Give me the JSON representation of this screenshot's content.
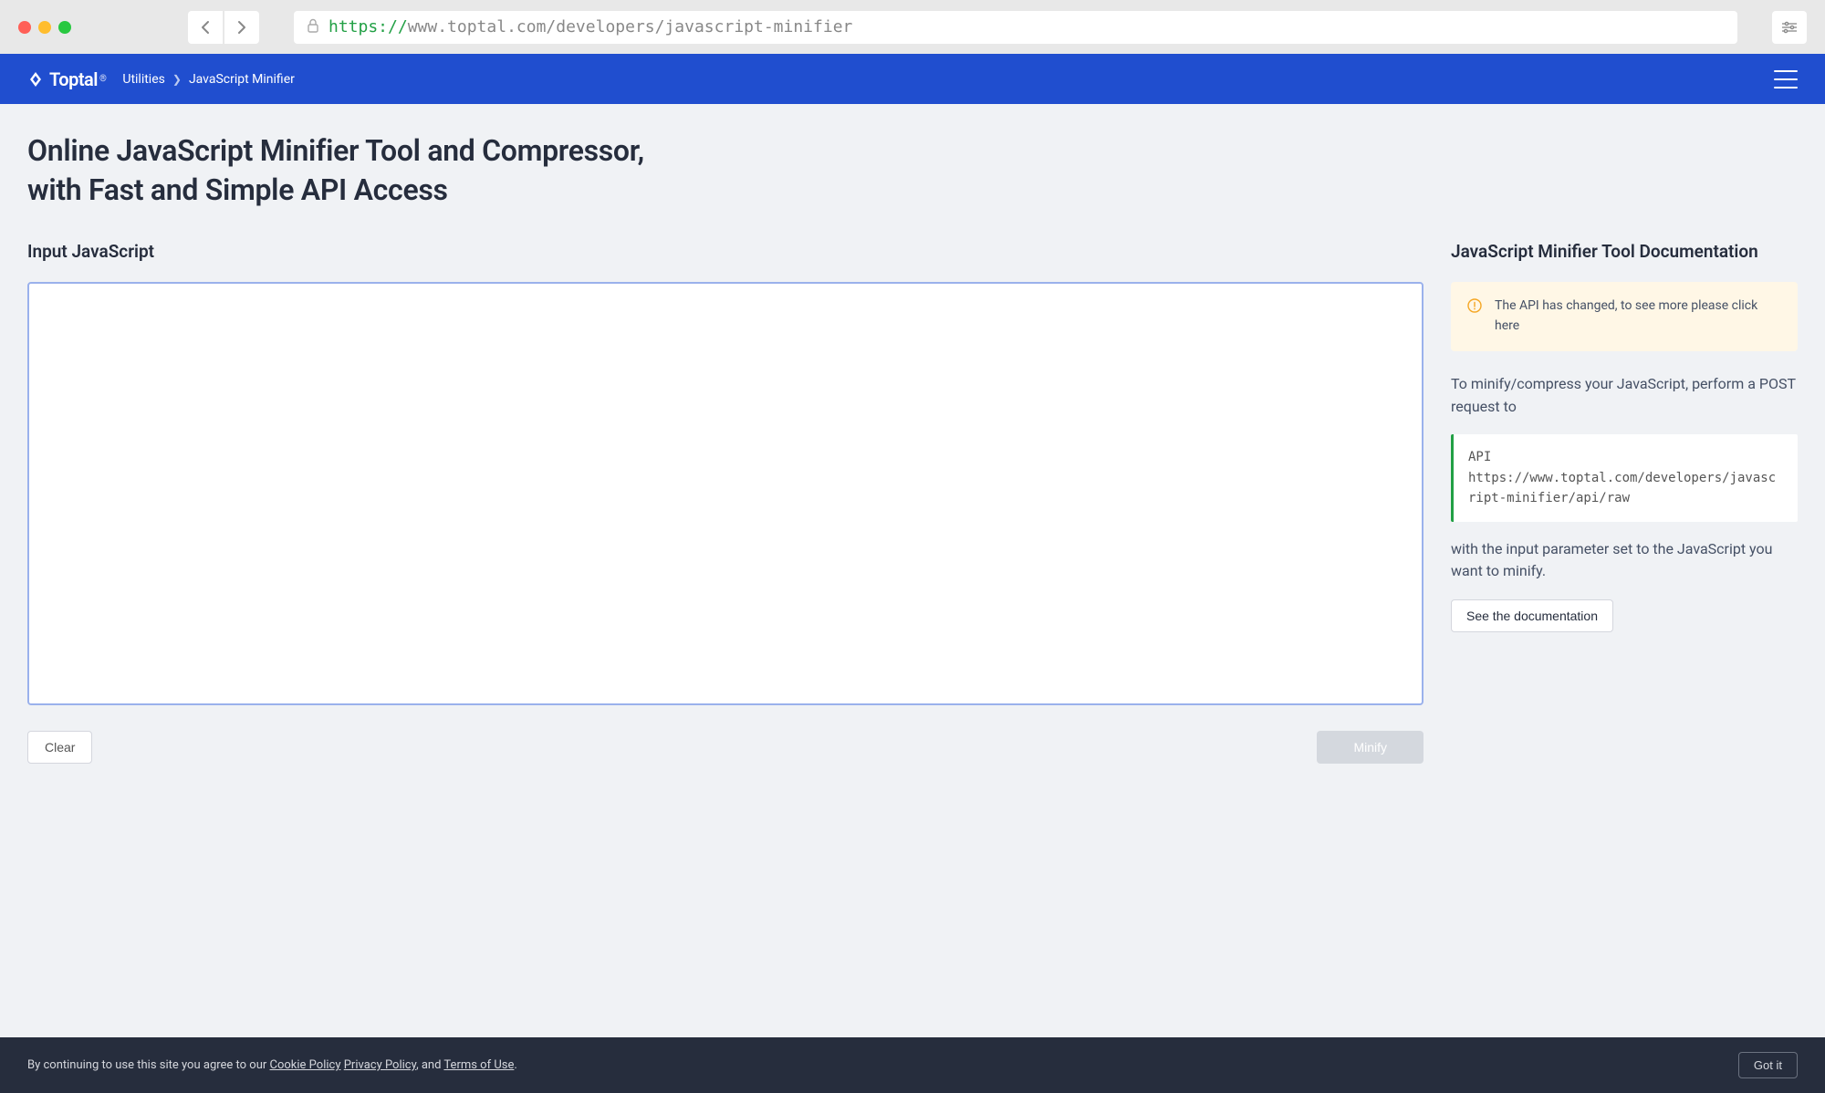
{
  "browser": {
    "url_protocol": "https://",
    "url_rest": "www.toptal.com/developers/javascript-minifier"
  },
  "header": {
    "brand": "Toptal",
    "breadcrumb_parent": "Utilities",
    "breadcrumb_current": "JavaScript Minifier"
  },
  "main": {
    "title": "Online JavaScript Minifier Tool and Compressor, with Fast and Simple API Access",
    "input_label": "Input JavaScript",
    "clear_btn": "Clear",
    "minify_btn": "Minify"
  },
  "doc": {
    "heading": "JavaScript Minifier Tool Documentation",
    "notice": "The API has changed, to see more please click here",
    "p1": "To minify/compress your JavaScript, perform a POST request to",
    "code_label": "API",
    "code_url": "https://www.toptal.com/developers/javascript-minifier/api/raw",
    "p2": "with the input parameter set to the JavaScript you want to minify.",
    "doc_btn": "See the documentation"
  },
  "cookie": {
    "prefix": "By continuing to use this site you agree to our ",
    "cookie_policy": "Cookie Policy",
    "privacy_policy": "Privacy Policy",
    "and": ", and ",
    "terms": "Terms of Use",
    "dot": ".",
    "got_it": "Got it"
  }
}
